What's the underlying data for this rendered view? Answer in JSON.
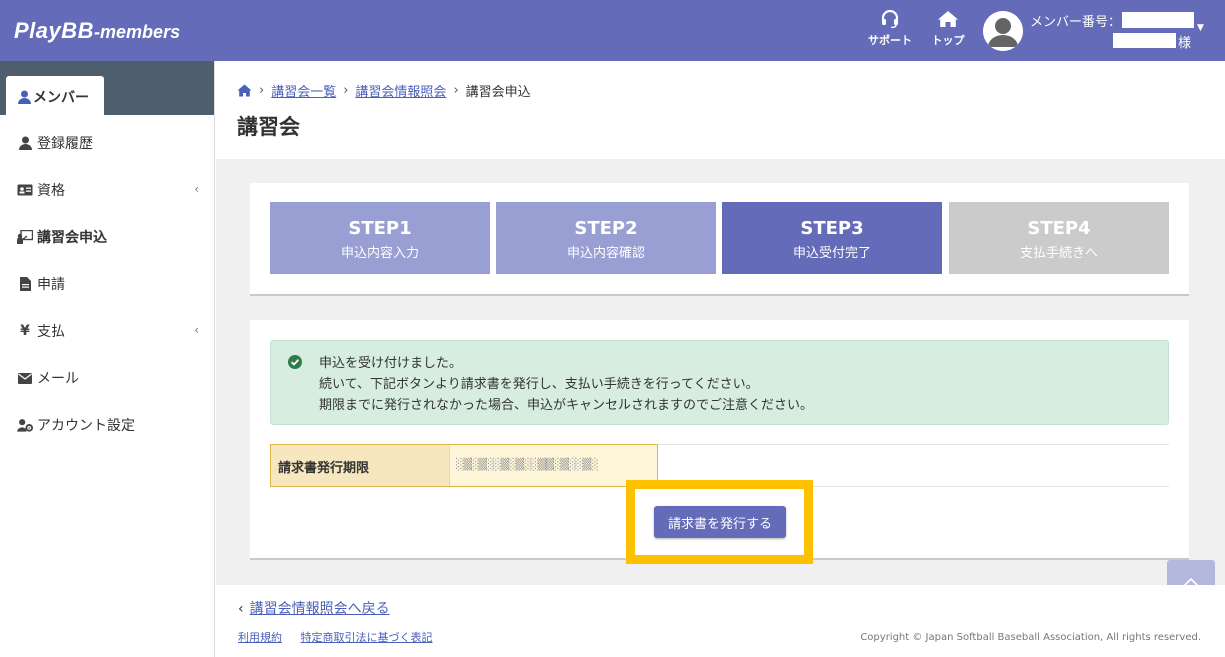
{
  "header": {
    "logo_main": "PlayBB",
    "logo_sub": "-members",
    "support_label": "サポート",
    "top_label": "トップ",
    "member_number_label": "メンバー番号：",
    "honorific": "様"
  },
  "sidebar": {
    "tab_label": "メンバー",
    "items": [
      {
        "label": "登録履歴",
        "icon": "user-icon"
      },
      {
        "label": "資格",
        "icon": "id-card-icon",
        "expandable": true
      },
      {
        "label": "講習会申込",
        "icon": "teacher-icon",
        "active": true
      },
      {
        "label": "申請",
        "icon": "file-icon"
      },
      {
        "label": "支払",
        "icon": "yen-icon",
        "expandable": true
      },
      {
        "label": "メール",
        "icon": "envelope-icon"
      },
      {
        "label": "アカウント設定",
        "icon": "user-cog-icon"
      }
    ]
  },
  "breadcrumb": {
    "items": [
      "講習会一覧",
      "講習会情報照会"
    ],
    "current": "講習会申込"
  },
  "page_title": "講習会",
  "steps": [
    {
      "title": "STEP1",
      "sub": "申込内容入力",
      "color": "#9a9fd3"
    },
    {
      "title": "STEP2",
      "sub": "申込内容確認",
      "color": "#9a9fd3"
    },
    {
      "title": "STEP3",
      "sub": "申込受付完了",
      "color": "#646bb9"
    },
    {
      "title": "STEP4",
      "sub": "支払手続きへ",
      "color": "#cbcbcb"
    }
  ],
  "alert": {
    "line1": "申込を受け付けました。",
    "line2": "続いて、下記ボタンより請求書を発行し、支払い手続きを行ってください。",
    "line3": "期限までに発行されなかった場合、申込がキャンセルされますのでご注意ください。"
  },
  "deadline": {
    "label": "請求書発行期限"
  },
  "issue_button": "請求書を発行する",
  "footer": {
    "back_link": "講習会情報照会へ戻る",
    "terms": "利用規約",
    "tokushoho": "特定商取引法に基づく表記",
    "copyright": "Copyright © Japan Softball Baseball Association, All rights reserved."
  },
  "colors": {
    "header": "#646bb9",
    "sidebar_top": "#4f5e6c",
    "alert_bg": "#d7ede0",
    "highlight": "#ffc000"
  }
}
